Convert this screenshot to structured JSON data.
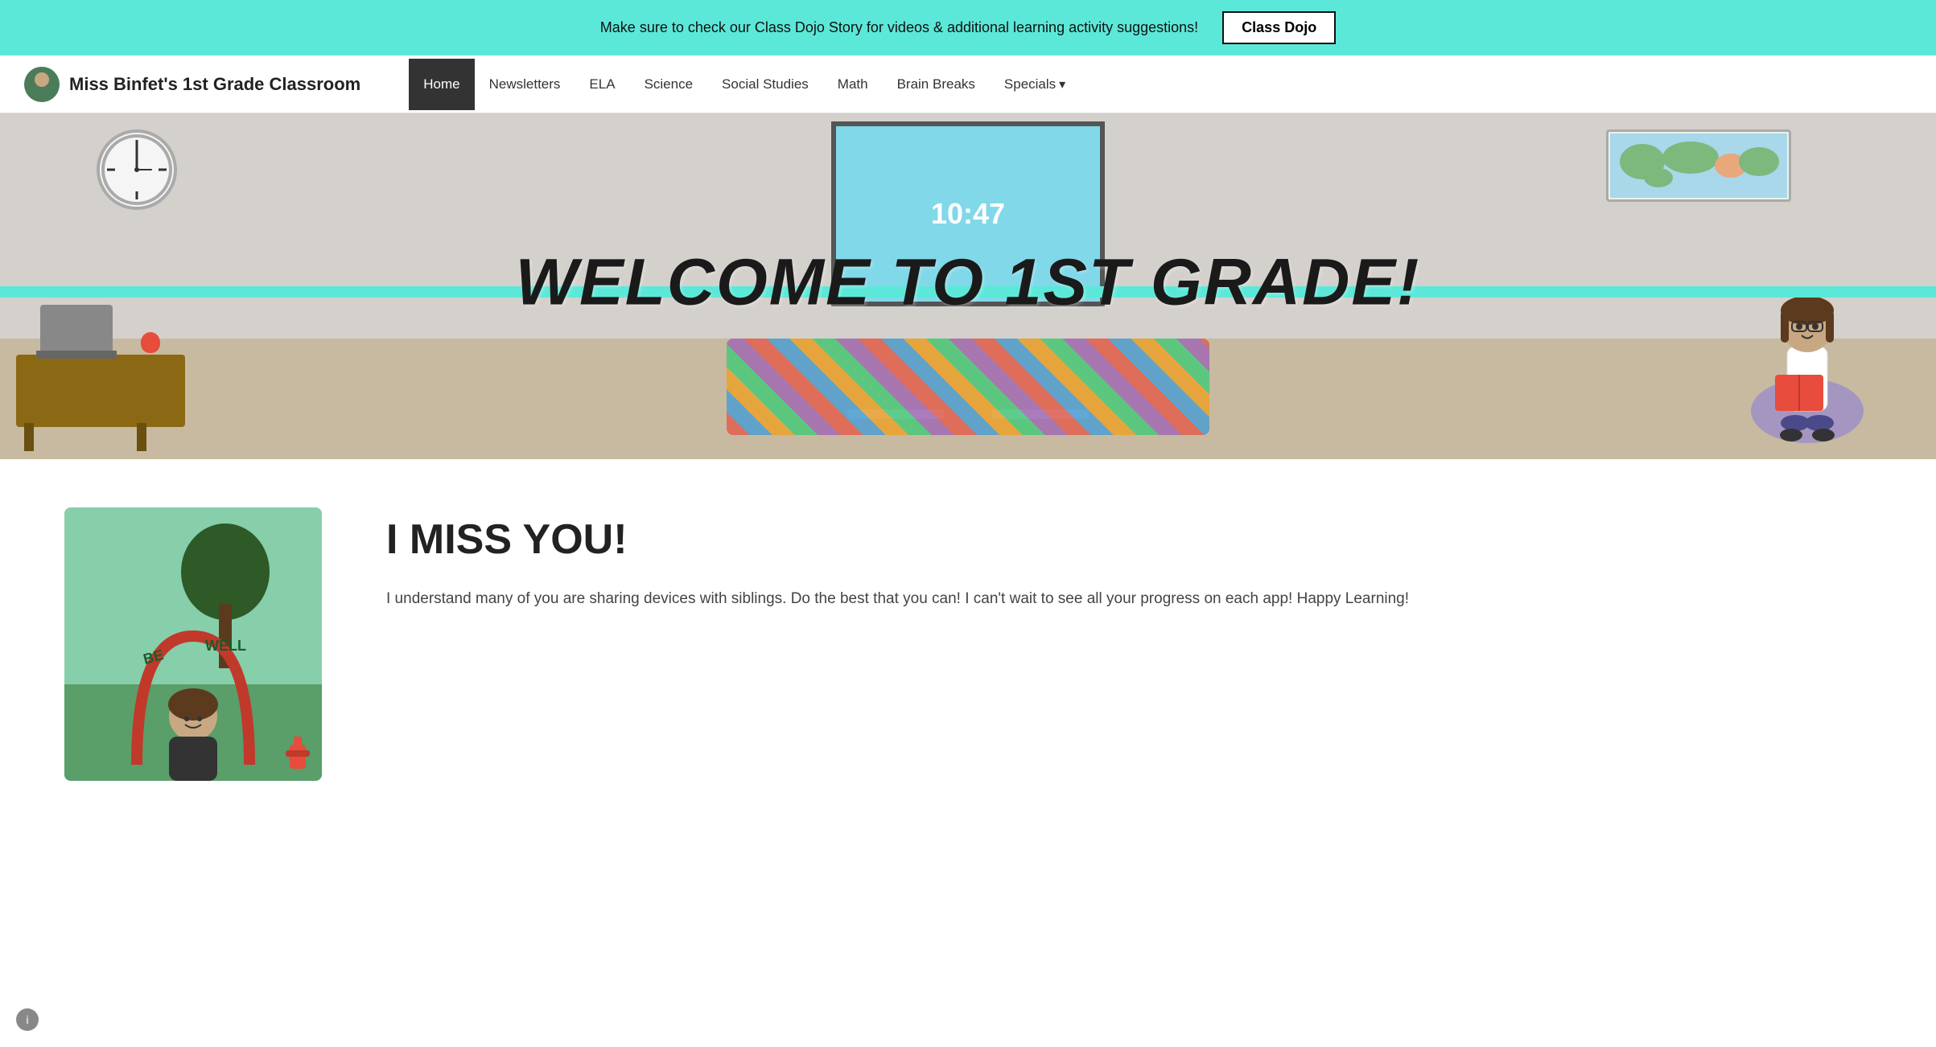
{
  "banner": {
    "text": "Make sure to check our Class Dojo Story for videos & additional learning activity suggestions!",
    "button_label": "Class Dojo"
  },
  "navbar": {
    "site_title": "Miss Binfet's 1st Grade Classroom",
    "nav_items": [
      {
        "label": "Home",
        "active": true
      },
      {
        "label": "Newsletters",
        "active": false
      },
      {
        "label": "ELA",
        "active": false
      },
      {
        "label": "Science",
        "active": false
      },
      {
        "label": "Social Studies",
        "active": false
      },
      {
        "label": "Math",
        "active": false
      },
      {
        "label": "Brain Breaks",
        "active": false
      },
      {
        "label": "Specials",
        "active": false,
        "dropdown": true
      }
    ]
  },
  "hero": {
    "title": "WELCOME TO 1ST GRADE!",
    "smart_board_time": "10:47"
  },
  "content": {
    "heading": "I MISS YOU!",
    "body_text": "I understand many of you are sharing devices with siblings. Do the best that you can! I can't wait to see all your progress on each app! Happy Learning!"
  }
}
